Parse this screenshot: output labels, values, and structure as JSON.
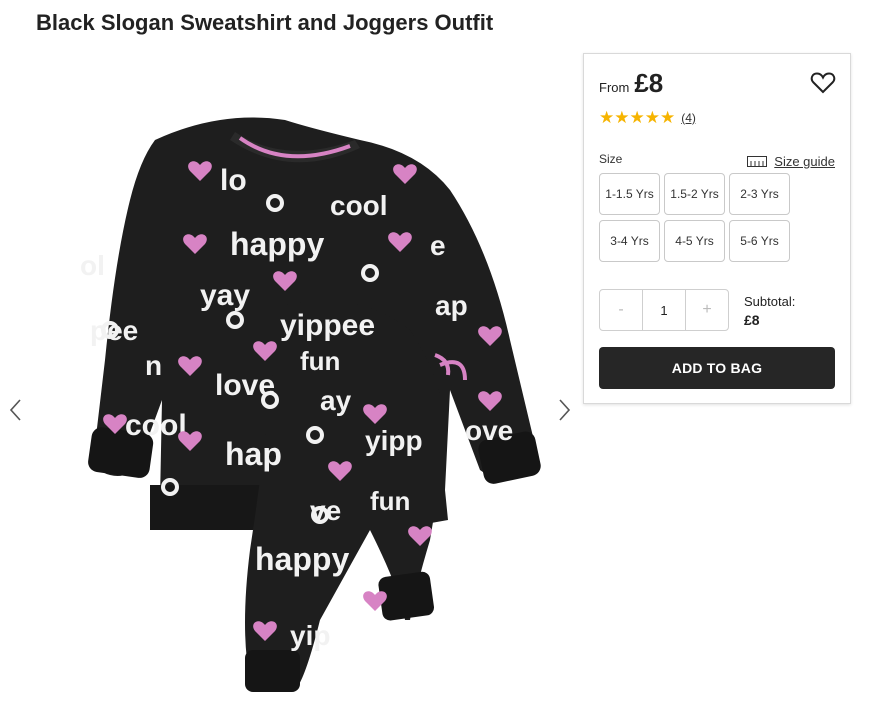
{
  "product": {
    "title": "Black Slogan Sweatshirt and Joggers Outfit"
  },
  "gallery": {
    "image_icon": "sweatshirt-joggers-outfit-image",
    "prev_icon": "chevron-left-icon",
    "next_icon": "chevron-right-icon",
    "print_words": [
      "love",
      "cool",
      "happy",
      "yay",
      "yippee",
      "fun"
    ]
  },
  "purchase": {
    "from_label": "From",
    "price": "£8",
    "wishlist_icon": "heart-outline-icon",
    "rating": {
      "stars": "★★★★★",
      "value": 5,
      "count": "(4)"
    },
    "size_label": "Size",
    "size_guide": {
      "icon": "ruler-icon",
      "label": "Size guide"
    },
    "sizes": [
      "1-1.5 Yrs",
      "1.5-2 Yrs",
      "2-3 Yrs",
      "3-4 Yrs",
      "4-5 Yrs",
      "5-6 Yrs"
    ],
    "quantity": {
      "minus": "-",
      "value": "1",
      "plus": "+"
    },
    "subtotal": {
      "label": "Subtotal:",
      "amount": "£8"
    },
    "add_to_bag": "ADD TO BAG"
  },
  "colors": {
    "garment": "#1e1e1e",
    "heart": "#d783c4",
    "text_print": "#f2f2f2",
    "star": "#f6b400",
    "button": "#262626"
  }
}
